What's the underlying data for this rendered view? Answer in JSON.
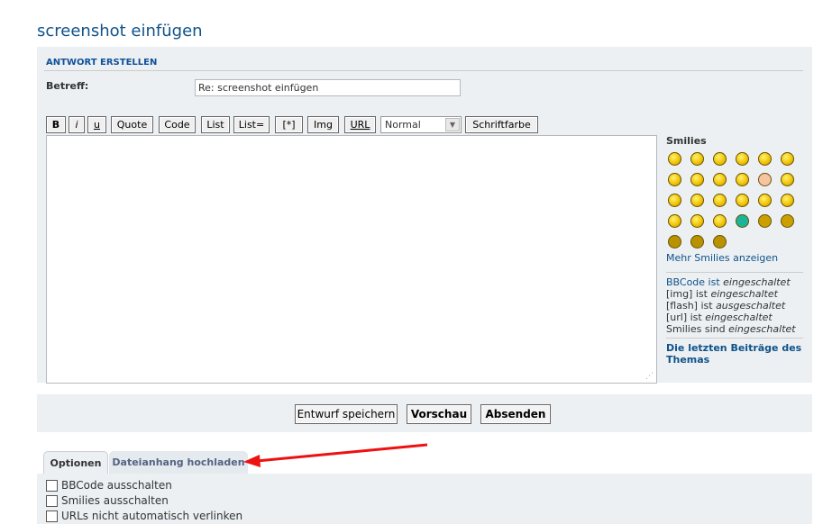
{
  "page_title": "screenshot einfügen",
  "section_title": "ANTWORT ERSTELLEN",
  "subject": {
    "label": "Betreff:",
    "value": "Re: screenshot einfügen"
  },
  "toolbar": {
    "buttons": [
      "B",
      "i",
      "u",
      "Quote",
      "Code",
      "List",
      "List=",
      "[*]",
      "Img",
      "URL"
    ],
    "font_size": "Normal",
    "font_color": "Schriftfarbe"
  },
  "smilies": {
    "title": "Smilies",
    "count": 27,
    "more": "Mehr Smilies anzeigen"
  },
  "status": [
    {
      "label": "BBCode ist ",
      "value": "eingeschaltet"
    },
    {
      "label": "[img] ist ",
      "value": "eingeschaltet"
    },
    {
      "label": "[flash] ist ",
      "value": "ausgeschaltet"
    },
    {
      "label": "[url] ist ",
      "value": "eingeschaltet"
    },
    {
      "label": "Smilies sind ",
      "value": "eingeschaltet"
    }
  ],
  "recent_posts": "Die letzten Beiträge des Themas",
  "actions": {
    "draft": "Entwurf speichern",
    "preview": "Vorschau",
    "submit": "Absenden"
  },
  "tabs": [
    {
      "label": "Optionen",
      "active": true
    },
    {
      "label": "Dateianhang hochladen",
      "active": false
    }
  ],
  "options": [
    "BBCode ausschalten",
    "Smilies ausschalten",
    "URLs nicht automatisch verlinken"
  ],
  "colors": {
    "accent": "#105289",
    "panel": "#ECF0F3",
    "annotation_arrow": "#ee1111"
  }
}
